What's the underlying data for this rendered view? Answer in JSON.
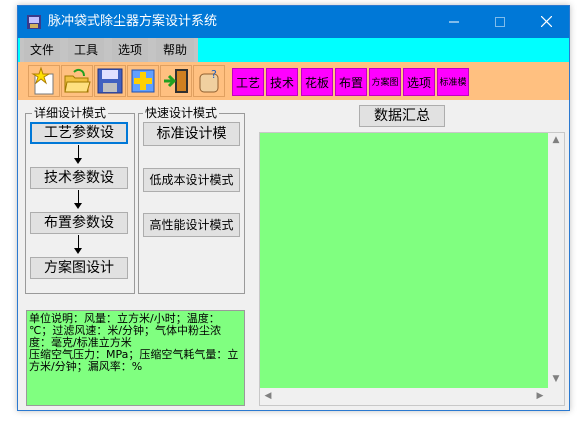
{
  "window": {
    "title": "脉冲袋式除尘器方案设计系统",
    "min_icon": "minimize-icon",
    "max_icon": "maximize-icon",
    "close_icon": "close-icon"
  },
  "menu": {
    "items": [
      {
        "label": "文件"
      },
      {
        "label": "工具"
      },
      {
        "label": "选项"
      },
      {
        "label": "帮助"
      }
    ]
  },
  "toolbar": {
    "icon_buttons": [
      {
        "icon": "new-star-icon"
      },
      {
        "icon": "open-folder-icon"
      },
      {
        "icon": "save-disk-icon"
      },
      {
        "icon": "add-plus-icon"
      },
      {
        "icon": "exit-door-icon"
      },
      {
        "icon": "help-hand-icon"
      }
    ],
    "text_buttons": [
      {
        "label": "工艺"
      },
      {
        "label": "技术"
      },
      {
        "label": "花板"
      },
      {
        "label": "布置"
      },
      {
        "label": "方案图"
      },
      {
        "label": "选项"
      },
      {
        "label": "标准模"
      }
    ]
  },
  "detail_mode": {
    "title": "详细设计模式",
    "buttons": [
      {
        "label": "工艺参数设"
      },
      {
        "label": "技术参数设"
      },
      {
        "label": "布置参数设"
      },
      {
        "label": "方案图设计"
      }
    ]
  },
  "quick_mode": {
    "title": "快速设计模式",
    "buttons": [
      {
        "label": "标准设计模"
      },
      {
        "label": "低成本设计模式"
      },
      {
        "label": "高性能设计模式"
      }
    ]
  },
  "summary": {
    "button_label": "数据汇总"
  },
  "units": {
    "text": "单位说明：风量：立方米/小时；温度：℃；过滤风速：米/分钟；气体中粉尘浓度：毫克/标准立方米\n压缩空气压力：MPa；压缩空气耗气量：立方米/分钟；漏风率：%"
  },
  "colors": {
    "titlebar": "#0078d7",
    "menubar": "#00ffff",
    "toolbar": "#ffc080",
    "toolbar_text_buttons": "#ff00ff",
    "green_panels": "#80ff80"
  }
}
